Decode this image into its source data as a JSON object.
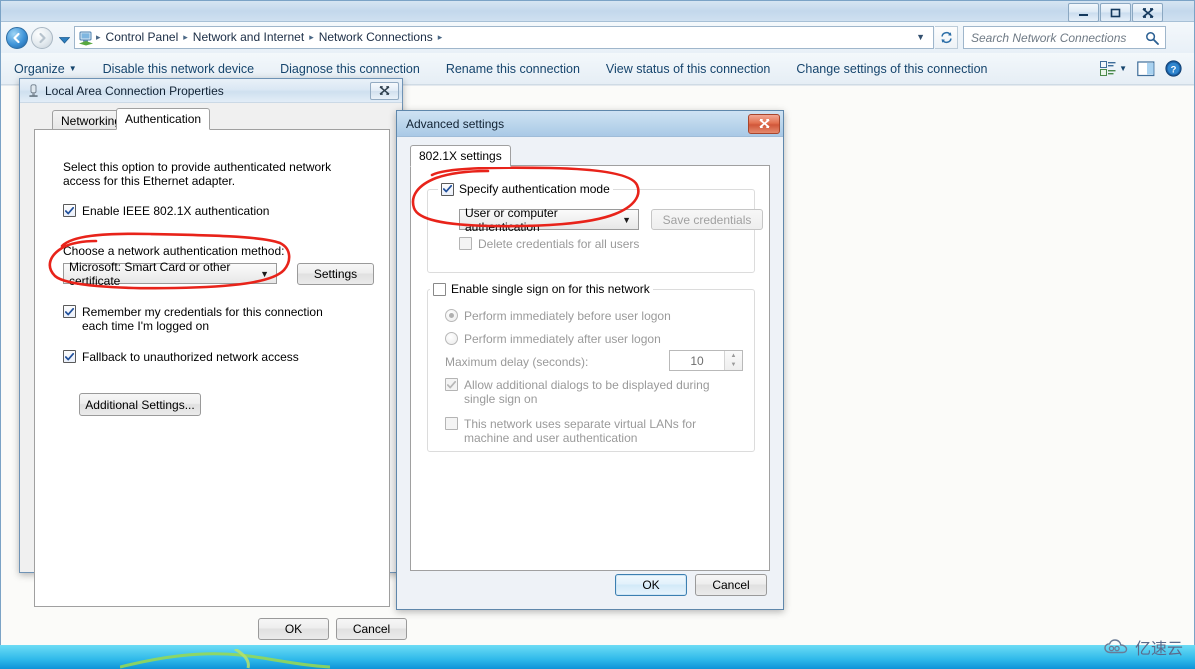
{
  "explorer": {
    "titlebar": {
      "minimize_label": "Minimize",
      "maximize_label": "Maximize",
      "close_label": "Close"
    },
    "address": {
      "breadcrumbs": [
        "Control Panel",
        "Network and Internet",
        "Network Connections"
      ],
      "separator": "▸",
      "dropdown_caret": "▼",
      "icon_name": "network-connections-icon"
    },
    "search": {
      "placeholder": "Search Network Connections",
      "value": ""
    },
    "command_bar": {
      "items": [
        {
          "label": "Organize",
          "has_caret": true
        },
        {
          "label": "Disable this network device",
          "has_caret": false
        },
        {
          "label": "Diagnose this connection",
          "has_caret": false
        },
        {
          "label": "Rename this connection",
          "has_caret": false
        },
        {
          "label": "View status of this connection",
          "has_caret": false
        },
        {
          "label": "Change settings of this connection",
          "has_caret": false
        }
      ],
      "view_button_label": "Change your view",
      "preview_button_label": "Show the preview pane",
      "help_button_label": "Get help"
    }
  },
  "properties_dialog": {
    "title": "Local Area Connection Properties",
    "close_label": "Close",
    "tabs": [
      {
        "label": "Networking",
        "active": false
      },
      {
        "label": "Authentication",
        "active": true
      }
    ],
    "description": "Select this option to provide authenticated network access for this Ethernet adapter.",
    "enable_8021x": {
      "label": "Enable IEEE 802.1X authentication",
      "checked": true
    },
    "method_label": "Choose a network authentication method:",
    "method_value": "Microsoft: Smart Card or other certificate",
    "settings_button": "Settings",
    "remember_credentials": {
      "label": "Remember my credentials for this connection each time I'm logged on",
      "checked": true
    },
    "fallback": {
      "label": "Fallback to unauthorized network access",
      "checked": true
    },
    "additional_settings_button": "Additional Settings...",
    "ok_button": "OK",
    "cancel_button": "Cancel"
  },
  "advanced_dialog": {
    "title": "Advanced settings",
    "close_label": "Close",
    "tabs": [
      {
        "label": "802.1X settings",
        "active": true
      }
    ],
    "auth_mode_group": {
      "checkbox_label": "Specify authentication mode",
      "checked": true,
      "combo_value": "User or computer authentication",
      "save_credentials_button": "Save credentials",
      "save_credentials_enabled": false,
      "delete_credentials": {
        "label": "Delete credentials for all users",
        "checked": false,
        "enabled": false
      }
    },
    "sso_group": {
      "checkbox_label": "Enable single sign on for this network",
      "checked": false,
      "radio_before": {
        "label": "Perform immediately before user logon",
        "selected": true
      },
      "radio_after": {
        "label": "Perform immediately after user logon",
        "selected": false
      },
      "max_delay_label": "Maximum delay (seconds):",
      "max_delay_value": "10",
      "allow_dialogs": {
        "label": "Allow additional dialogs to be displayed during single sign on",
        "checked": true
      },
      "separate_vlans": {
        "label": "This network uses separate virtual LANs for machine and user authentication",
        "checked": false
      }
    },
    "ok_button": "OK",
    "cancel_button": "Cancel"
  },
  "annotations": {
    "ink_color": "#e8231a",
    "marks": [
      {
        "name": "circle-around-auth-method-combo"
      },
      {
        "name": "circle-around-specify-auth-mode"
      }
    ]
  },
  "watermark": {
    "text": "亿速云",
    "icon_name": "cloud-icon",
    "color": "#5a6b8c"
  }
}
